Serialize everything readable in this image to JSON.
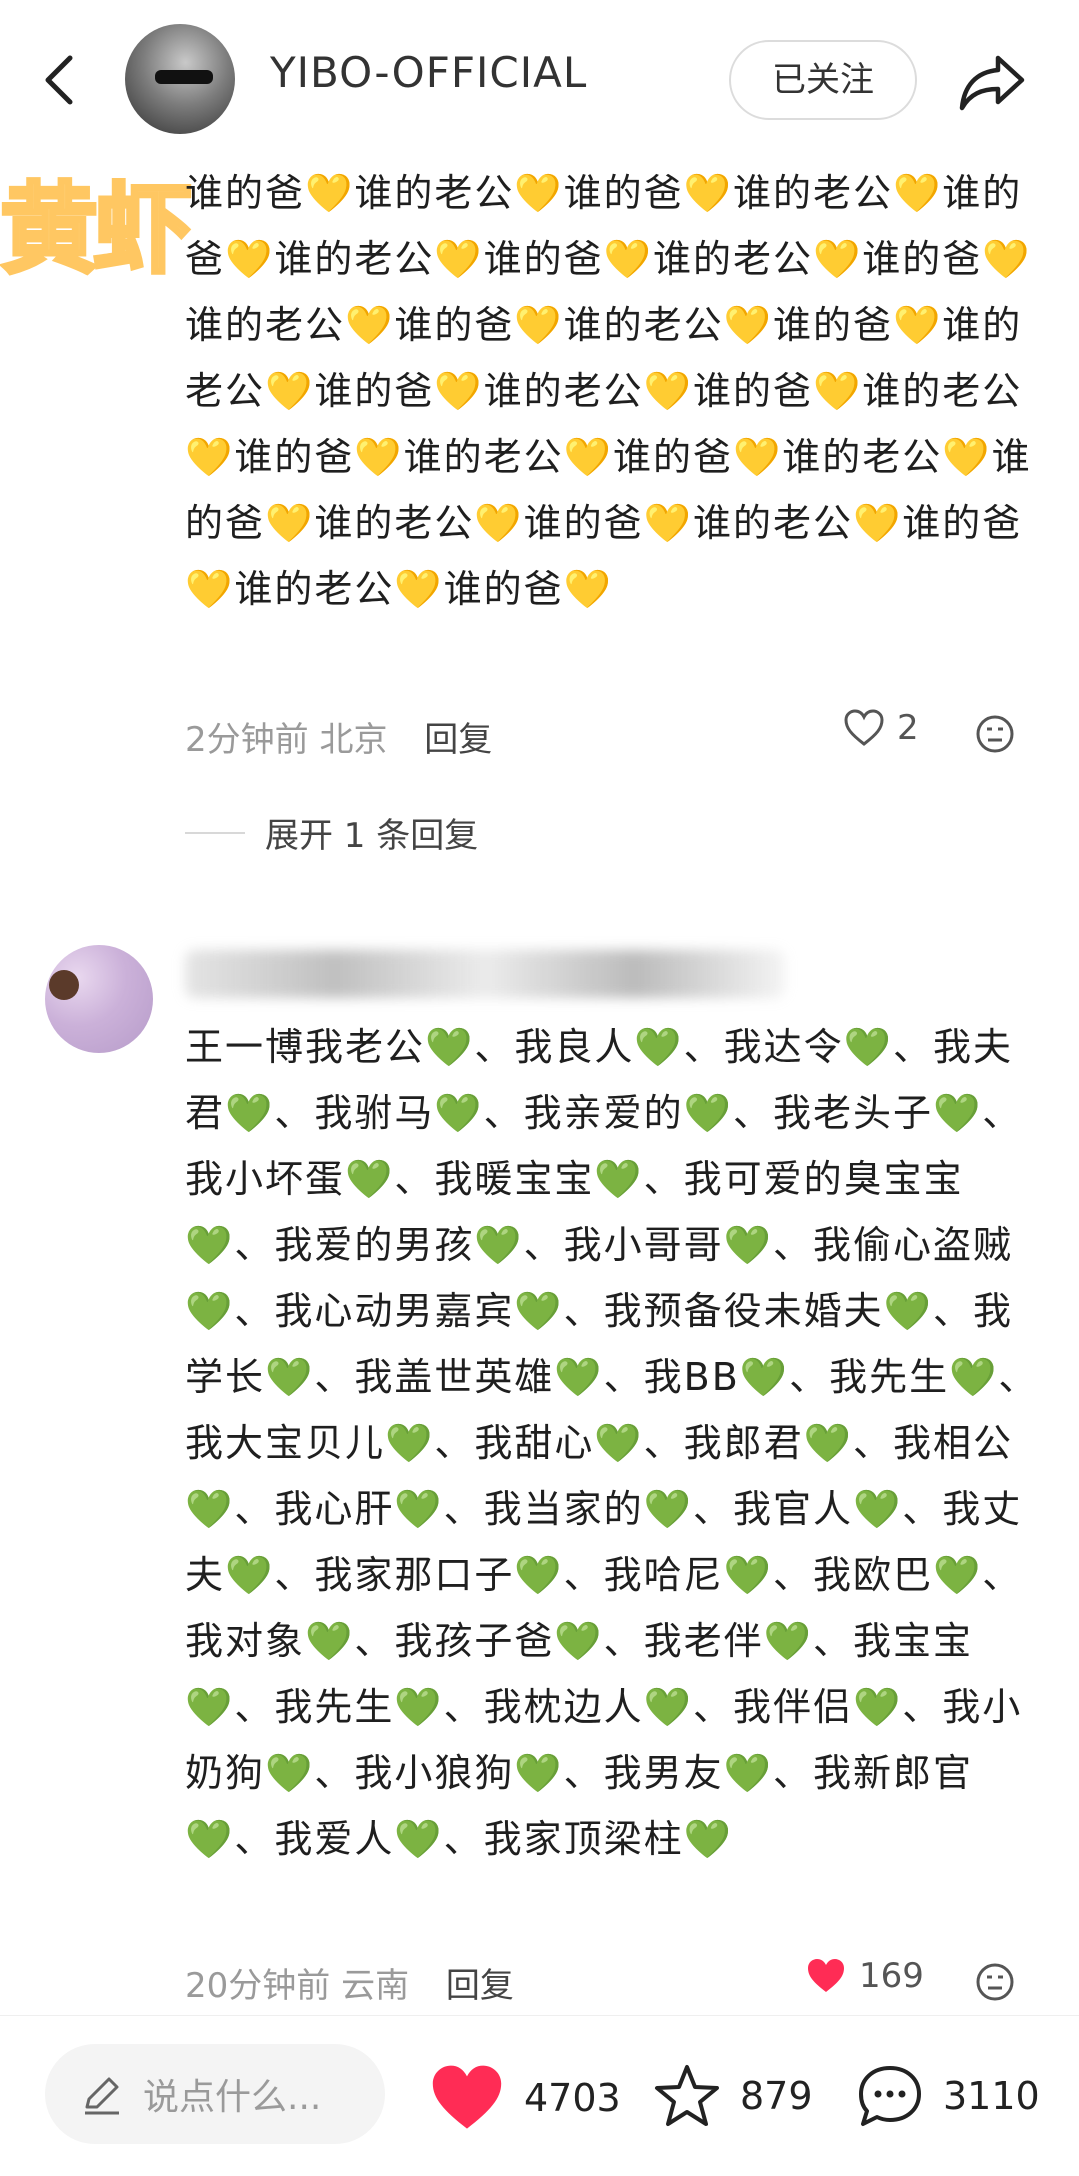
{
  "header": {
    "username": "YIBO-OFFICIAL",
    "follow_label": "已关注"
  },
  "watermark": "黄虾",
  "comment1": {
    "text": "谁的爸💛谁的老公💛谁的爸💛谁的老公💛谁的爸💛谁的老公💛谁的爸💛谁的老公💛谁的爸💛谁的老公💛谁的爸💛谁的老公💛谁的爸💛谁的老公💛谁的爸💛谁的老公💛谁的爸💛谁的老公💛谁的爸💛谁的老公💛谁的爸💛谁的老公💛谁的爸💛谁的老公💛谁的爸💛谁的老公💛谁的爸💛谁的老公💛谁的爸💛",
    "time": "2分钟前",
    "location": "北京",
    "reply_label": "回复",
    "likes": "2",
    "expand_label": "展开 1 条回复"
  },
  "comment2": {
    "text": "王一博我老公💚、我良人💚、我达令💚、我夫君💚、我驸马💚、我亲爱的💚、我老头子💚、我小坏蛋💚、我暖宝宝💚、我可爱的臭宝宝💚、我爱的男孩💚、我小哥哥💚、我偷心盗贼💚、我心动男嘉宾💚、我预备役未婚夫💚、我学长💚、我盖世英雄💚、我BB💚、我先生💚、我大宝贝儿💚、我甜心💚、我郎君💚、我相公💚、我心肝💚、我当家的💚、我官人💚、我丈夫💚、我家那口子💚、我哈尼💚、我欧巴💚、我对象💚、我孩子爸💚、我老伴💚、我宝宝💚、我先生💚、我枕边人💚、我伴侣💚、我小奶狗💚、我小狼狗💚、我男友💚、我新郎官💚、我爱人💚、我家顶梁柱💚",
    "time": "20分钟前",
    "location": "云南",
    "reply_label": "回复",
    "likes": "169"
  },
  "bottom_bar": {
    "input_placeholder": "说点什么...",
    "likes": "4703",
    "stars": "879",
    "comments": "3110"
  },
  "colors": {
    "like_red": "#ff2c55",
    "watermark_orange": "#ffc55a"
  }
}
